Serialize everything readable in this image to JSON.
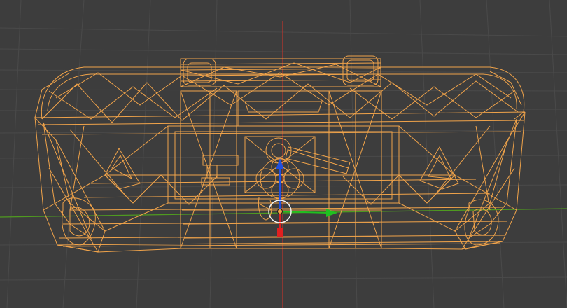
{
  "viewport": {
    "mode": "wireframe",
    "object_selected": true
  },
  "colors": {
    "background": "#3d3d3d",
    "grid": "#4a4a4a",
    "wire": "#f0a34a",
    "axis_x": "#b3372e",
    "axis_y": "#4f9a20",
    "gizmo_x": "#e02020",
    "gizmo_y": "#20c020",
    "gizmo_z": "#2050e0",
    "gizmo_origin": "#f2f2f2"
  },
  "icons": {
    "transform_gizmo": "move-gizmo-icon",
    "object_origin": "origin-icon"
  }
}
